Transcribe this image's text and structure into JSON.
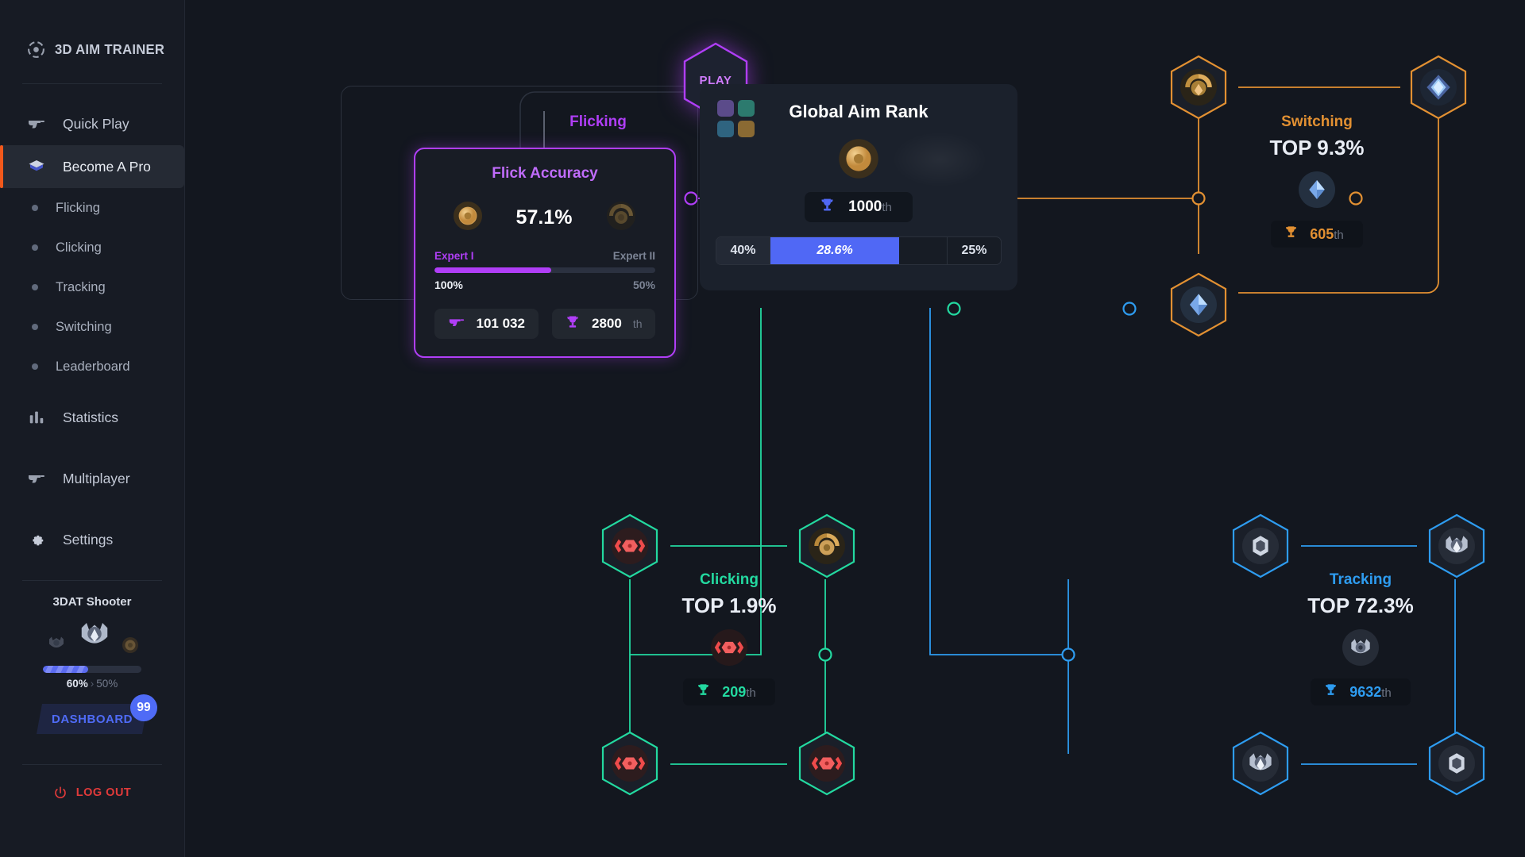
{
  "brand": {
    "name": "3D AIM TRAINER",
    "icon": "crosshair-icon"
  },
  "sidebar": {
    "nav": [
      {
        "label": "Quick Play",
        "icon": "pistol-icon",
        "active": false
      },
      {
        "label": "Become A Pro",
        "icon": "graduation-icon",
        "active": true
      }
    ],
    "sub_items": [
      {
        "label": "Flicking"
      },
      {
        "label": "Clicking"
      },
      {
        "label": "Tracking"
      },
      {
        "label": "Switching"
      },
      {
        "label": "Leaderboard"
      }
    ],
    "nav2": [
      {
        "label": "Statistics",
        "icon": "bar-chart-icon"
      },
      {
        "label": "Multiplayer",
        "icon": "pistol-icon"
      },
      {
        "label": "Settings",
        "icon": "gear-icon"
      }
    ],
    "shooter": {
      "title": "3DAT Shooter",
      "xp_percent": 46,
      "current": "60%",
      "arrow": "›",
      "next": "50%"
    },
    "dashboard": {
      "label": "DASHBOARD",
      "badge": "99"
    },
    "logout": {
      "label": "LOG OUT",
      "icon": "power-icon"
    }
  },
  "flicking": {
    "group_label": "Flicking",
    "play_label": "PLAY",
    "card_title": "Flick Accuracy",
    "accuracy": "57.1%",
    "tier_current": "Expert I",
    "tier_next": "Expert II",
    "tier_progress": 53,
    "tier_current_pct": "100%",
    "tier_next_pct": "50%",
    "score": "101 032",
    "rank": "2800",
    "rank_suffix": "th",
    "accent": "#b03ef7"
  },
  "global_rank": {
    "title": "Global Aim Rank",
    "rank": "1000",
    "rank_suffix": "th",
    "left_pct": "40%",
    "fill_pct": "28.6%",
    "right_pct": "25%",
    "squares": [
      "#5b4b8a",
      "#2c7a6e",
      "#2f6480",
      "#8a6a33"
    ],
    "accent": "#5068f5"
  },
  "skills": [
    {
      "key": "switching",
      "label": "Switching",
      "top": "TOP 9.3%",
      "rank": "605",
      "rank_suffix": "th",
      "accent": "#e29032",
      "medal": "diamond-icon",
      "nodes": [
        "medal-gold-icon",
        "crystal-blue-icon",
        "diamond-icon",
        "diamond-icon"
      ]
    },
    {
      "key": "clicking",
      "label": "Clicking",
      "top": "TOP 1.9%",
      "rank": "209",
      "rank_suffix": "th",
      "accent": "#23d9a0",
      "medal": "red-hex-icon",
      "nodes": [
        "red-hex-icon",
        "medal-gold-icon",
        "red-hex-icon",
        "red-hex-icon"
      ]
    },
    {
      "key": "tracking",
      "label": "Tracking",
      "top": "TOP 72.3%",
      "rank": "9632",
      "rank_suffix": "th",
      "accent": "#2e9cf0",
      "medal": "silver-visor-icon",
      "nodes": [
        "silver-ring-icon",
        "silver-visor-icon",
        "silver-visor-icon",
        "silver-ring-icon"
      ]
    }
  ]
}
